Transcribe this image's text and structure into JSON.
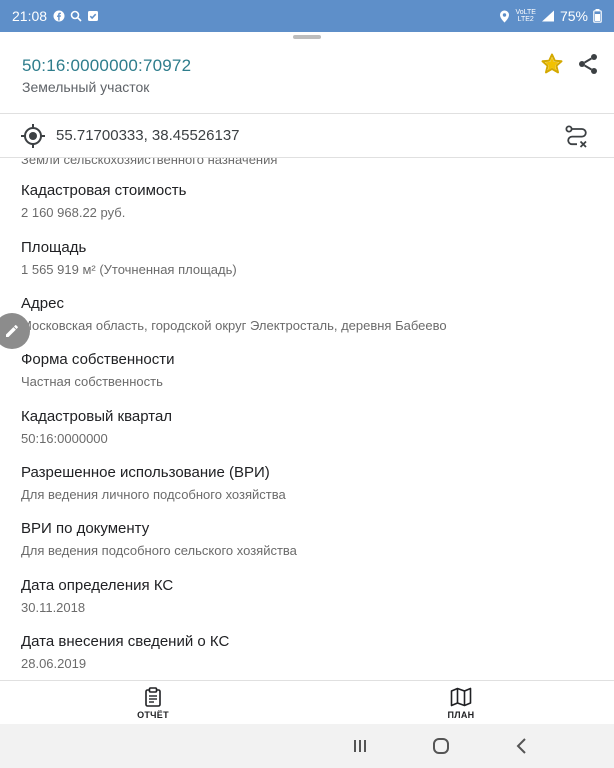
{
  "status_bar": {
    "time": "21:08",
    "network_top": "VoLTE",
    "network_bottom": "LTE2",
    "battery": "75%",
    "icons": [
      "facebook-icon",
      "search-icon",
      "check-icon",
      "location-icon",
      "signal-icon",
      "battery-icon"
    ]
  },
  "header": {
    "cadastral_number": "50:16:0000000:70972",
    "property_type": "Земельный участок"
  },
  "coordinates": {
    "value": "55.71700333, 38.45526137"
  },
  "cut_text": "Земли сельскохозяйственного назначения",
  "fields": [
    {
      "label": "Кадастровая стоимость",
      "value": "2 160 968.22 руб."
    },
    {
      "label": "Площадь",
      "value": "1 565 919 м² (Уточненная площадь)"
    },
    {
      "label": "Адрес",
      "value": "Московская область, городской округ Электросталь, деревня Бабеево"
    },
    {
      "label": "Форма собственности",
      "value": "Частная собственность"
    },
    {
      "label": "Кадастровый квартал",
      "value": "50:16:0000000"
    },
    {
      "label": "Разрешенное использование (ВРИ)",
      "value": "Для ведения личного подсобного хозяйства"
    },
    {
      "label": "ВРИ по документу",
      "value": "Для ведения подсобного сельского хозяйства"
    },
    {
      "label": "Дата определения КС",
      "value": "30.11.2018"
    },
    {
      "label": "Дата внесения сведений о КС",
      "value": "28.06.2019"
    }
  ],
  "bottom_bar": {
    "report_label": "ОТЧЁТ",
    "plan_label": "ПЛАН"
  },
  "colors": {
    "status_bar": "#5e8fc9",
    "accent_teal": "#2e7d8c",
    "star": "#f2c200"
  }
}
